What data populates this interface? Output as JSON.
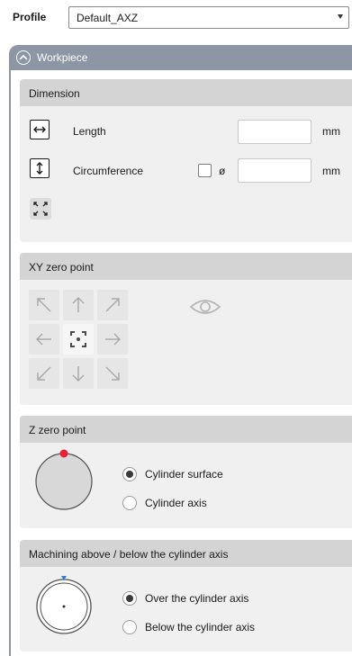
{
  "profile": {
    "label": "Profile",
    "value": "Default_AXZ"
  },
  "workpiece": {
    "title": "Workpiece"
  },
  "dimension": {
    "title": "Dimension",
    "length_label": "Length",
    "length_value": "",
    "length_unit": "mm",
    "circumference_label": "Circumference",
    "diameter_symbol": "ø",
    "circumference_value": "",
    "circumference_unit": "mm",
    "diameter_checked": false
  },
  "xy_zero": {
    "title": "XY zero point",
    "selected": "center"
  },
  "z_zero": {
    "title": "Z zero point",
    "options": [
      {
        "label": "Cylinder surface",
        "selected": true
      },
      {
        "label": "Cylinder axis",
        "selected": false
      }
    ]
  },
  "machining": {
    "title": "Machining above / below the cylinder axis",
    "options": [
      {
        "label": "Over the cylinder axis",
        "selected": true
      },
      {
        "label": "Below the cylinder axis",
        "selected": false
      }
    ]
  },
  "colors": {
    "panel_header": "#8c96a4",
    "group_header": "#d4d4d4",
    "zero_marker": "#e8213a",
    "axis_marker": "#2f7fd6"
  }
}
